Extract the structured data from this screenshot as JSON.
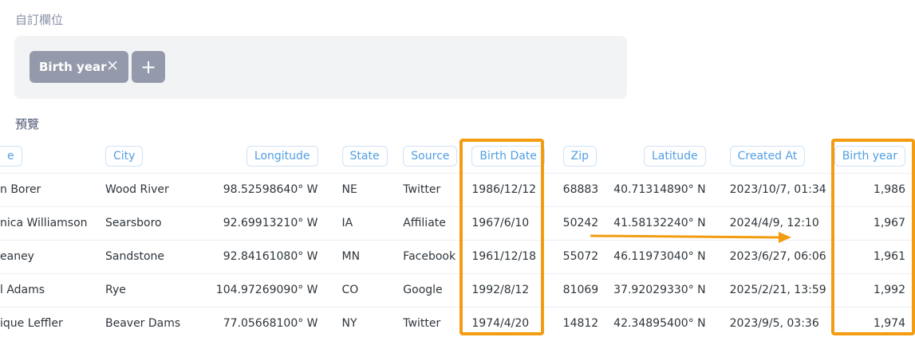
{
  "custom_columns": {
    "title": "自訂欄位",
    "chip_label": "Birth year",
    "chip_remove": "✕",
    "add_button": "+"
  },
  "preview": {
    "title": "預覽",
    "columns": [
      "e",
      "City",
      "Longitude",
      "State",
      "Source",
      "Birth Date",
      "Zip",
      "Latitude",
      "Created At",
      "Birth year"
    ],
    "rows": [
      [
        "n Borer",
        "Wood River",
        "98.52598640° W",
        "NE",
        "Twitter",
        "1986/12/12",
        "68883",
        "40.71314890° N",
        "2023/10/7, 01:34",
        "1,986"
      ],
      [
        "nica Williamson",
        "Searsboro",
        "92.69913210° W",
        "IA",
        "Affiliate",
        "1967/6/10",
        "50242",
        "41.58132240° N",
        "2024/4/9, 12:10",
        "1,967"
      ],
      [
        "eaney",
        "Sandstone",
        "92.84161080° W",
        "MN",
        "Facebook",
        "1961/12/18",
        "55072",
        "46.11973040° N",
        "2023/6/27, 06:06",
        "1,961"
      ],
      [
        "l Adams",
        "Rye",
        "104.97269090° W",
        "CO",
        "Google",
        "1992/8/12",
        "81069",
        "37.92029330° N",
        "2025/2/21, 13:59",
        "1,992"
      ],
      [
        "ique Leffler",
        "Beaver Dams",
        "77.05668100° W",
        "NY",
        "Twitter",
        "1974/4/20",
        "14812",
        "42.34895400° N",
        "2023/9/5, 03:36",
        "1,974"
      ]
    ]
  },
  "colors": {
    "highlight": "#f39c12",
    "pill_text": "#509ee3",
    "chip_bg": "#949aab"
  }
}
